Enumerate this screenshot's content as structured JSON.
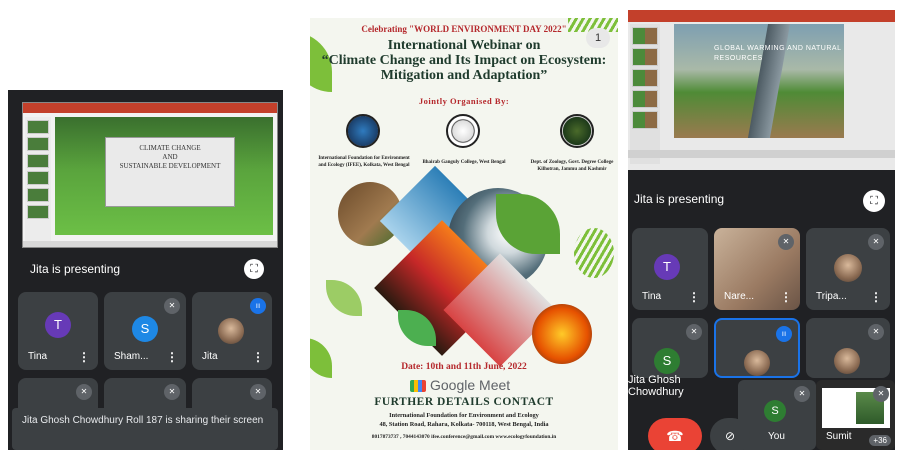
{
  "left": {
    "slide_title_1": "CLIMATE CHANGE",
    "slide_title_2": "AND",
    "slide_title_3": "SUSTAINABLE DEVELOPMENT",
    "presenting": "Jita is presenting",
    "tiles": [
      {
        "initial": "T",
        "name": "Tina",
        "color": "#673ab7"
      },
      {
        "initial": "S",
        "name": "Sham...",
        "color": "#1e88e5"
      },
      {
        "initial": "",
        "name": "Jita",
        "color": ""
      }
    ],
    "toast": "Jita Ghosh Chowdhury Roll 187 is sharing their screen"
  },
  "poster": {
    "page": "1",
    "celebrating": "Celebrating \"WORLD ENVIRONMENT DAY 2022\"",
    "title_1": "International Webinar on",
    "title_2": "“Climate Change and Its Impact on Ecosystem:",
    "title_3": "Mitigation and Adaptation”",
    "jointly": "Jointly Organised By:",
    "orgs": [
      "International Foundation for Environment and Ecology (IFEE), Kolkata, West Bengal",
      "Bhairab Ganguly College, West Bengal",
      "Dept. of Zoology, Govt. Degree College Kilhotran, Jammu and Kashmir"
    ],
    "date": "Date: 10th and 11th June, 2022",
    "meet": "Google Meet",
    "contact": "FURTHER DETAILS CONTACT",
    "addr1": "International Foundation for Environment and Ecology",
    "addr2": "48, Station Road, Rahara, Kolkata- 700118, West Bengal, India",
    "phones": "8017873737 , 7044143070  ifee.conference@gmail.com  www.ecologyfoundation.in"
  },
  "right": {
    "slide_title": "GLOBAL WARMING AND NATURAL RESOURCES",
    "presenting": "Jita is presenting",
    "tiles": [
      {
        "initial": "T",
        "name": "Tina",
        "color": "#673ab7"
      },
      {
        "initial": "",
        "name": "Nare...",
        "color": ""
      },
      {
        "initial": "",
        "name": "Tripa...",
        "color": ""
      },
      {
        "initial": "S",
        "name": "",
        "color": "#2e7d32"
      }
    ],
    "self_label": "Jita Ghosh Chowdhury",
    "you_initial": "S",
    "you_label": "You",
    "sumit_label": "Sumit",
    "more_count": "+36"
  }
}
